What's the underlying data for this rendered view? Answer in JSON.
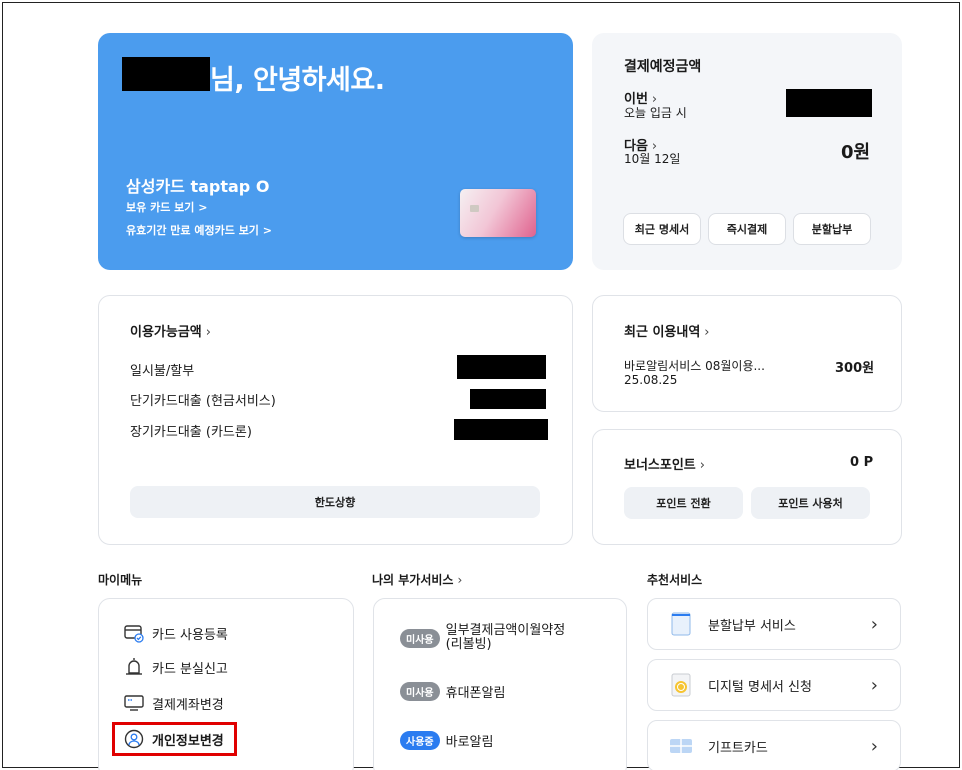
{
  "greeting": {
    "suffix": "님, 안녕하세요."
  },
  "card": {
    "name": "삼성카드 taptap O",
    "links": [
      "보유 카드 보기 >",
      "유효기간 만료 예정카드 보기 >"
    ]
  },
  "payment": {
    "title": "결제예정금액",
    "current_label": "이번",
    "current_sub": "오늘 입금 시",
    "next_label": "다음",
    "next_date": "10월 12일",
    "next_amount": "0원",
    "buttons": [
      "최근 명세서",
      "즉시결제",
      "분할납부"
    ]
  },
  "available": {
    "title": "이용가능금액",
    "rows": [
      "일시불/할부",
      "단기카드대출 (현금서비스)",
      "장기카드대출 (카드론)"
    ],
    "limit_button": "한도상향"
  },
  "recent": {
    "title": "최근 이용내역",
    "item": "바로알림서비스 08월이용...",
    "date": "25.08.25",
    "amount": "300원"
  },
  "bonus": {
    "title": "보너스포인트",
    "value": "0 P",
    "buttons": [
      "포인트 전환",
      "포인트 사용처"
    ]
  },
  "my_menu": {
    "title": "마이메뉴",
    "items": [
      "카드 사용등록",
      "카드 분실신고",
      "결제계좌변경",
      "개인정보변경"
    ]
  },
  "extra_services": {
    "title": "나의 부가서비스",
    "items": [
      {
        "badge": "미사용",
        "label": "일부결제금액이월약정",
        "label2": "(리볼빙)"
      },
      {
        "badge": "미사용",
        "label": "휴대폰알림"
      },
      {
        "badge": "사용중",
        "label": "바로알림"
      }
    ]
  },
  "recommended": {
    "title": "추천서비스",
    "items": [
      "분할납부 서비스",
      "디지털 명세서 신청",
      "기프트카드"
    ]
  },
  "icons": {
    "chevron": "chevron-right-icon"
  }
}
